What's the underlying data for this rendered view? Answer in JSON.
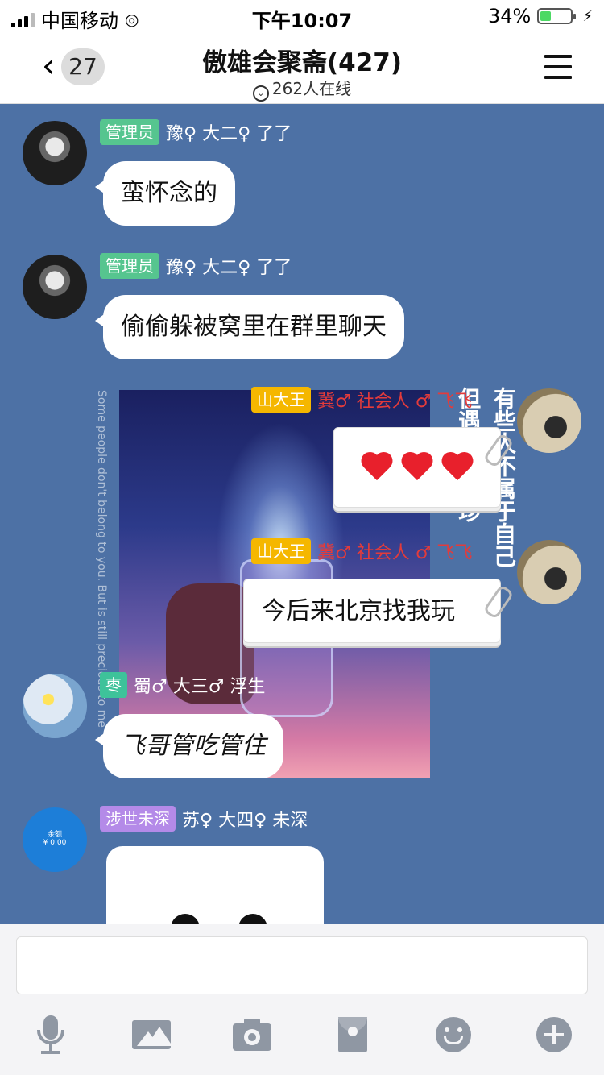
{
  "status_bar": {
    "carrier": "中国移动",
    "time": "下午10:07",
    "battery": "34%",
    "battery_level": 0.34
  },
  "header": {
    "back_count": "27",
    "title": "傲雄会聚斋(427)",
    "online": "262人在线"
  },
  "messages": [
    {
      "badge": "管理员",
      "badge_color": "#56c58f",
      "meta": "豫♀ 大二♀ 了了",
      "text": "蛮怀念的"
    },
    {
      "badge": "管理员",
      "badge_color": "#56c58f",
      "meta": "豫♀ 大二♀ 了了",
      "text": "偷偷躲被窝里在群里聊天"
    },
    {
      "badge": "山大王",
      "badge_color": "#f5b700",
      "meta": "冀♂ 社会人 ♂ 飞飞",
      "text": "❤❤❤"
    },
    {
      "badge": "山大王",
      "badge_color": "#f5b700",
      "meta": "冀♂ 社会人 ♂ 飞飞",
      "text": "今后来北京找我玩"
    },
    {
      "badge": "枣",
      "badge_color": "#3ec29a",
      "meta": "蜀♂ 大三♂ 浮生",
      "text": "飞哥管吃管住"
    },
    {
      "badge": "涉世未深",
      "badge_color": "#b48ae8",
      "meta": "苏♀ 大四♀ 未深"
    }
  ],
  "background_image": {
    "vertical_en": "Some people don't belong to you. But is still precious to me",
    "vertical_cn_1": "有些人不属于自己",
    "vertical_cn_2": "但遇见弥足珍"
  },
  "blue_avatar": {
    "line1": "余额",
    "line2": "¥ 0.00"
  },
  "toolbar_icons": [
    "microphone-icon",
    "picture-icon",
    "camera-icon",
    "red-packet-icon",
    "emoji-icon",
    "plus-icon"
  ]
}
